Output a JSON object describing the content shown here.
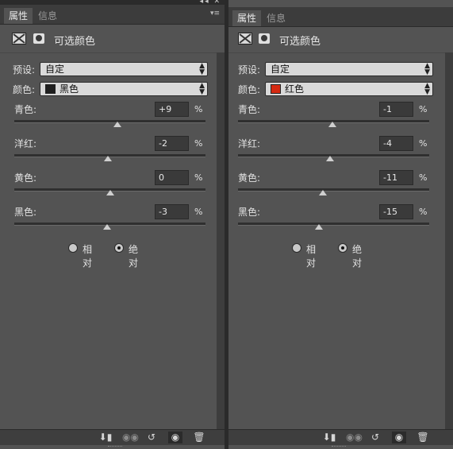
{
  "window": {
    "controls": "◂◂ ✕"
  },
  "panels": [
    {
      "tabs": [
        "属性",
        "信息"
      ],
      "title": "可选颜色",
      "preset_label": "预设:",
      "preset_value": "自定",
      "color_label": "颜色:",
      "color_value": "黑色",
      "swatch_color": "#1f1f1f",
      "sliders": [
        {
          "label": "青色:",
          "value": "+9",
          "unit": "%",
          "level": 0.54
        },
        {
          "label": "洋红:",
          "value": "-2",
          "unit": "%",
          "level": 0.49
        },
        {
          "label": "黄色:",
          "value": "0",
          "unit": "%",
          "level": 0.5
        },
        {
          "label": "黑色:",
          "value": "-3",
          "unit": "%",
          "level": 0.485
        }
      ],
      "method": {
        "relative": "相对",
        "absolute": "绝对",
        "selected": "absolute"
      }
    },
    {
      "tabs": [
        "属性",
        "信息"
      ],
      "title": "可选颜色",
      "preset_label": "预设:",
      "preset_value": "自定",
      "color_label": "颜色:",
      "color_value": "红色",
      "swatch_color": "#d42a12",
      "sliders": [
        {
          "label": "青色:",
          "value": "-1",
          "unit": "%",
          "level": 0.495
        },
        {
          "label": "洋红:",
          "value": "-4",
          "unit": "%",
          "level": 0.48
        },
        {
          "label": "黄色:",
          "value": "-11",
          "unit": "%",
          "level": 0.445
        },
        {
          "label": "黑色:",
          "value": "-15",
          "unit": "%",
          "level": 0.425
        }
      ],
      "method": {
        "relative": "相对",
        "absolute": "绝对",
        "selected": "absolute"
      }
    }
  ],
  "bottom_icons": [
    "clip-to-layer-icon",
    "view-previous-icon",
    "reset-icon",
    "visibility-eye-icon",
    "trash-icon"
  ]
}
